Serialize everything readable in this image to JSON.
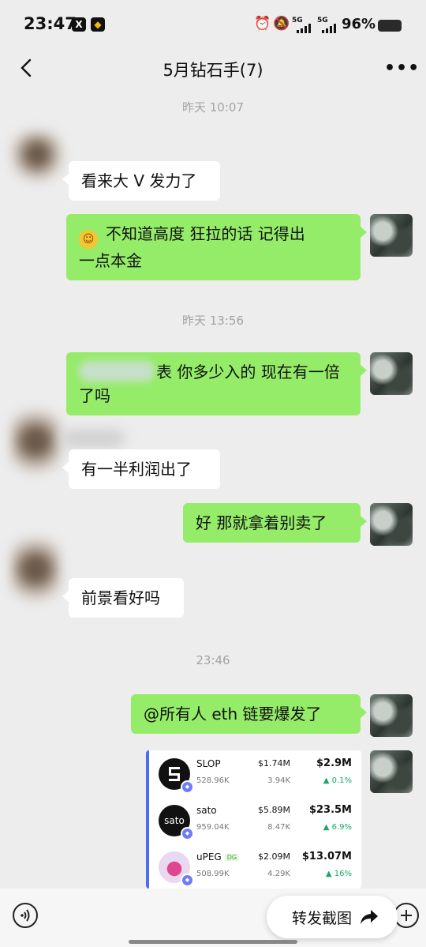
{
  "status_bar": {
    "time": "23:47",
    "app_x": "X",
    "app_binance": "◆",
    "net1": "5G",
    "net2": "5G",
    "battery_pct": "96%"
  },
  "header": {
    "title": "5月钻石手(7)"
  },
  "messages": {
    "ts1": "昨天 10:07",
    "m1": "看来大 V 发力了",
    "m2_line1": "不知道高度  狂拉的话 记得出",
    "m2_line2": "一点本金",
    "ts2": "昨天 13:56",
    "m3_line1": "表  你多少入的 现在有一倍",
    "m3_line2": "了吗",
    "m4": "有一半利润出了",
    "m5": "好 那就拿着别卖了",
    "m6": "前景看好吗",
    "ts3": "23:46",
    "m7": "@所有人  eth 链要爆发了"
  },
  "tokens": [
    {
      "name": "SLOP",
      "sub": "528.96K",
      "v1": "$1.74M",
      "v1s": "3.94K",
      "v2": "$2.9M",
      "pct": "▲ 0.1%"
    },
    {
      "name": "sato",
      "sub": "959.04K",
      "v1": "$5.89M",
      "v1s": "8.47K",
      "v2": "$23.5M",
      "pct": "▲ 6.9%"
    },
    {
      "name": "uPEG",
      "tag": "DG",
      "sub": "508.99K",
      "v1": "$2.09M",
      "v1s": "4.29K",
      "v2": "$13.07M",
      "pct": "▲ 16%"
    }
  ],
  "bottom": {
    "forward_label": "转发截图"
  },
  "colors": {
    "bubble_green": "#95ec69",
    "background": "#ededed",
    "card_accent": "#4a6cf7",
    "up_green": "#1aa864"
  }
}
